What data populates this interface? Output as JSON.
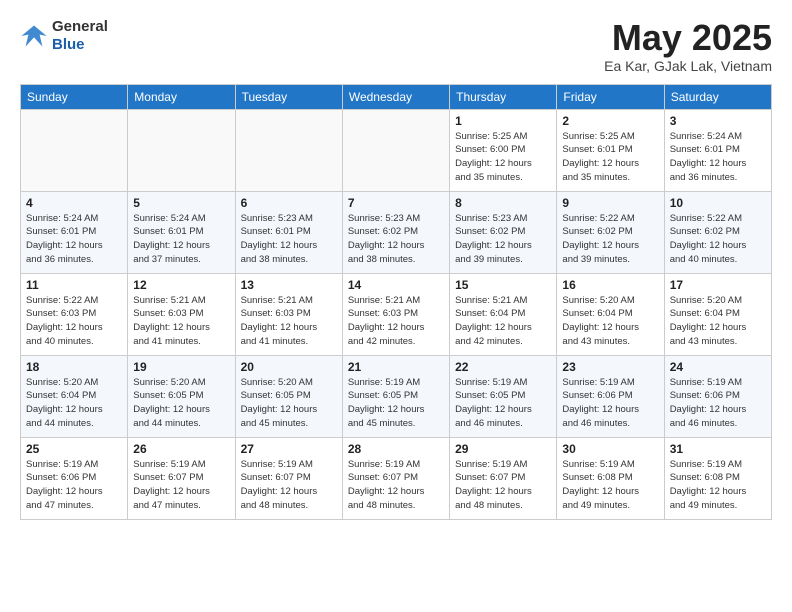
{
  "logo": {
    "general": "General",
    "blue": "Blue"
  },
  "header": {
    "month_year": "May 2025",
    "location": "Ea Kar, GJak Lak, Vietnam"
  },
  "days_of_week": [
    "Sunday",
    "Monday",
    "Tuesday",
    "Wednesday",
    "Thursday",
    "Friday",
    "Saturday"
  ],
  "weeks": [
    [
      {
        "day": "",
        "info": ""
      },
      {
        "day": "",
        "info": ""
      },
      {
        "day": "",
        "info": ""
      },
      {
        "day": "",
        "info": ""
      },
      {
        "day": "1",
        "info": "Sunrise: 5:25 AM\nSunset: 6:00 PM\nDaylight: 12 hours\nand 35 minutes."
      },
      {
        "day": "2",
        "info": "Sunrise: 5:25 AM\nSunset: 6:01 PM\nDaylight: 12 hours\nand 35 minutes."
      },
      {
        "day": "3",
        "info": "Sunrise: 5:24 AM\nSunset: 6:01 PM\nDaylight: 12 hours\nand 36 minutes."
      }
    ],
    [
      {
        "day": "4",
        "info": "Sunrise: 5:24 AM\nSunset: 6:01 PM\nDaylight: 12 hours\nand 36 minutes."
      },
      {
        "day": "5",
        "info": "Sunrise: 5:24 AM\nSunset: 6:01 PM\nDaylight: 12 hours\nand 37 minutes."
      },
      {
        "day": "6",
        "info": "Sunrise: 5:23 AM\nSunset: 6:01 PM\nDaylight: 12 hours\nand 38 minutes."
      },
      {
        "day": "7",
        "info": "Sunrise: 5:23 AM\nSunset: 6:02 PM\nDaylight: 12 hours\nand 38 minutes."
      },
      {
        "day": "8",
        "info": "Sunrise: 5:23 AM\nSunset: 6:02 PM\nDaylight: 12 hours\nand 39 minutes."
      },
      {
        "day": "9",
        "info": "Sunrise: 5:22 AM\nSunset: 6:02 PM\nDaylight: 12 hours\nand 39 minutes."
      },
      {
        "day": "10",
        "info": "Sunrise: 5:22 AM\nSunset: 6:02 PM\nDaylight: 12 hours\nand 40 minutes."
      }
    ],
    [
      {
        "day": "11",
        "info": "Sunrise: 5:22 AM\nSunset: 6:03 PM\nDaylight: 12 hours\nand 40 minutes."
      },
      {
        "day": "12",
        "info": "Sunrise: 5:21 AM\nSunset: 6:03 PM\nDaylight: 12 hours\nand 41 minutes."
      },
      {
        "day": "13",
        "info": "Sunrise: 5:21 AM\nSunset: 6:03 PM\nDaylight: 12 hours\nand 41 minutes."
      },
      {
        "day": "14",
        "info": "Sunrise: 5:21 AM\nSunset: 6:03 PM\nDaylight: 12 hours\nand 42 minutes."
      },
      {
        "day": "15",
        "info": "Sunrise: 5:21 AM\nSunset: 6:04 PM\nDaylight: 12 hours\nand 42 minutes."
      },
      {
        "day": "16",
        "info": "Sunrise: 5:20 AM\nSunset: 6:04 PM\nDaylight: 12 hours\nand 43 minutes."
      },
      {
        "day": "17",
        "info": "Sunrise: 5:20 AM\nSunset: 6:04 PM\nDaylight: 12 hours\nand 43 minutes."
      }
    ],
    [
      {
        "day": "18",
        "info": "Sunrise: 5:20 AM\nSunset: 6:04 PM\nDaylight: 12 hours\nand 44 minutes."
      },
      {
        "day": "19",
        "info": "Sunrise: 5:20 AM\nSunset: 6:05 PM\nDaylight: 12 hours\nand 44 minutes."
      },
      {
        "day": "20",
        "info": "Sunrise: 5:20 AM\nSunset: 6:05 PM\nDaylight: 12 hours\nand 45 minutes."
      },
      {
        "day": "21",
        "info": "Sunrise: 5:19 AM\nSunset: 6:05 PM\nDaylight: 12 hours\nand 45 minutes."
      },
      {
        "day": "22",
        "info": "Sunrise: 5:19 AM\nSunset: 6:05 PM\nDaylight: 12 hours\nand 46 minutes."
      },
      {
        "day": "23",
        "info": "Sunrise: 5:19 AM\nSunset: 6:06 PM\nDaylight: 12 hours\nand 46 minutes."
      },
      {
        "day": "24",
        "info": "Sunrise: 5:19 AM\nSunset: 6:06 PM\nDaylight: 12 hours\nand 46 minutes."
      }
    ],
    [
      {
        "day": "25",
        "info": "Sunrise: 5:19 AM\nSunset: 6:06 PM\nDaylight: 12 hours\nand 47 minutes."
      },
      {
        "day": "26",
        "info": "Sunrise: 5:19 AM\nSunset: 6:07 PM\nDaylight: 12 hours\nand 47 minutes."
      },
      {
        "day": "27",
        "info": "Sunrise: 5:19 AM\nSunset: 6:07 PM\nDaylight: 12 hours\nand 48 minutes."
      },
      {
        "day": "28",
        "info": "Sunrise: 5:19 AM\nSunset: 6:07 PM\nDaylight: 12 hours\nand 48 minutes."
      },
      {
        "day": "29",
        "info": "Sunrise: 5:19 AM\nSunset: 6:07 PM\nDaylight: 12 hours\nand 48 minutes."
      },
      {
        "day": "30",
        "info": "Sunrise: 5:19 AM\nSunset: 6:08 PM\nDaylight: 12 hours\nand 49 minutes."
      },
      {
        "day": "31",
        "info": "Sunrise: 5:19 AM\nSunset: 6:08 PM\nDaylight: 12 hours\nand 49 minutes."
      }
    ]
  ]
}
